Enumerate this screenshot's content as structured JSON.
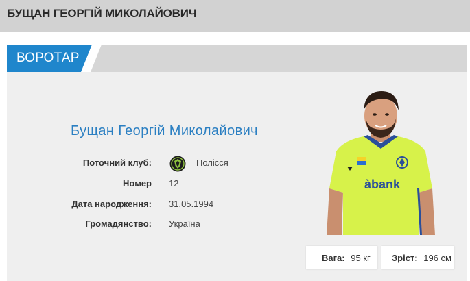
{
  "header": {
    "title": "БУЩАН ГЕОРГІЙ МИКОЛАЙОВИЧ"
  },
  "position": {
    "label": "ВОРОТАР"
  },
  "player": {
    "full_name": "Бущан Георгій Миколайович"
  },
  "info": {
    "club_label": "Поточний клуб:",
    "club_value": "Полісся",
    "club_logo_icon": "polissya-club-logo",
    "number_label": "Номер",
    "number_value": "12",
    "dob_label": "Дата народження:",
    "dob_value": "31.05.1994",
    "citizenship_label": "Громадянство:",
    "citizenship_value": "Україна"
  },
  "stats": {
    "weight_label": "Вага:",
    "weight_value": "95 кг",
    "height_label": "Зріст:",
    "height_value": "196 см"
  },
  "photo": {
    "shirt_sponsor": "àbank"
  },
  "colors": {
    "accent": "#1f86cc",
    "name": "#2b7fc2",
    "shirt": "#d7f24a"
  }
}
